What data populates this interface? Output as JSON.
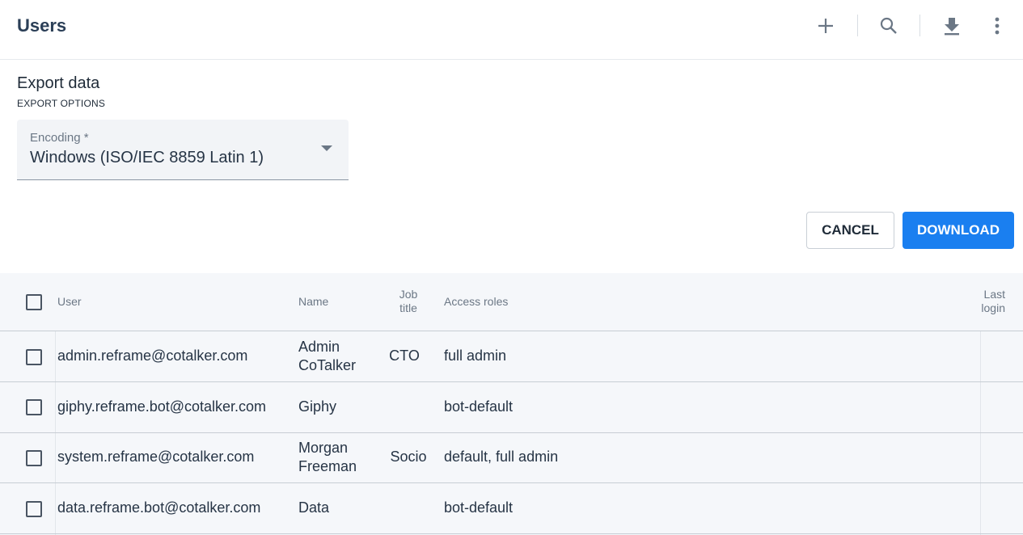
{
  "header": {
    "title": "Users",
    "icons": [
      "plus-icon",
      "search-icon",
      "download-icon",
      "more-vert-icon"
    ]
  },
  "export": {
    "heading": "Export data",
    "subheading": "EXPORT OPTIONS",
    "encoding": {
      "label": "Encoding *",
      "value": "Windows (ISO/IEC 8859 Latin 1)"
    },
    "cancel_label": "CANCEL",
    "download_label": "DOWNLOAD"
  },
  "colors": {
    "accent": "#1a7ff0",
    "title": "#2b3f57",
    "table_bg": "#f5f7fa"
  },
  "table": {
    "columns": {
      "user": "User",
      "name": "Name",
      "job_title_1": "Job",
      "job_title_2": "title",
      "access_roles": "Access roles",
      "last_login_1": "Last",
      "last_login_2": "login"
    },
    "rows": [
      {
        "user": "admin.reframe@cotalker.com",
        "name_1": "Admin",
        "name_2": "CoTalker",
        "job": "CTO",
        "roles": "full admin"
      },
      {
        "user": "giphy.reframe.bot@cotalker.com",
        "name_1": "Giphy",
        "name_2": "",
        "job": "",
        "roles": "bot-default"
      },
      {
        "user": "system.reframe@cotalker.com",
        "name_1": "Morgan",
        "name_2": "Freeman",
        "job": "Socio",
        "roles": "default, full admin"
      },
      {
        "user": "data.reframe.bot@cotalker.com",
        "name_1": "Data",
        "name_2": "",
        "job": "",
        "roles": "bot-default"
      }
    ]
  }
}
